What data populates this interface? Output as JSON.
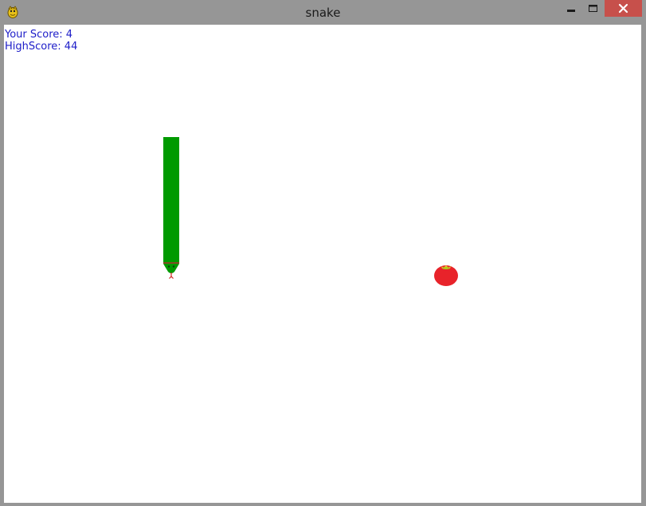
{
  "window": {
    "title": "snake",
    "app_icon": "pygame-snake-icon",
    "controls": [
      "minimize-icon",
      "maximize-icon",
      "close-icon"
    ],
    "close_color": "#c7504b"
  },
  "hud": {
    "score_label": "Your Score: 4",
    "highscore_label": "HighScore: 44",
    "text_color": "#1c1cc8"
  },
  "game": {
    "snake_color": "#009a00",
    "apple_color": "#e8232a",
    "background": "#ffffff"
  }
}
